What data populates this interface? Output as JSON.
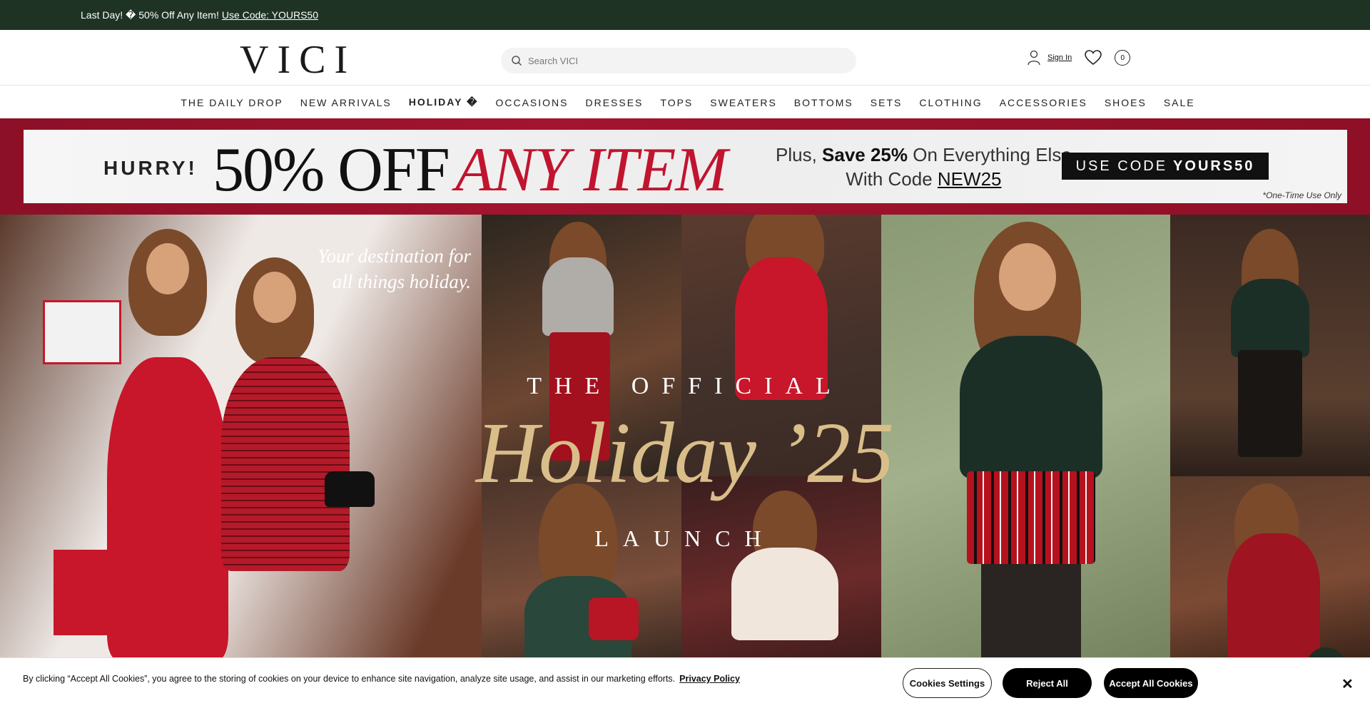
{
  "announcement": {
    "text": "Last Day! \u0000 50% Off Any Item! ",
    "text_clean": "Last Day! � 50% Off Any Item!",
    "code_link": "Use Code: YOURS50"
  },
  "header": {
    "logo": "VICI",
    "search_placeholder": "Search VICI",
    "sign_in": "Sign In",
    "cart_count": "0"
  },
  "nav": {
    "items": [
      {
        "label": "THE DAILY DROP"
      },
      {
        "label": "NEW ARRIVALS"
      },
      {
        "label": "HOLIDAY �"
      },
      {
        "label": "OCCASIONS"
      },
      {
        "label": "DRESSES"
      },
      {
        "label": "TOPS"
      },
      {
        "label": "SWEATERS"
      },
      {
        "label": "BOTTOMS"
      },
      {
        "label": "SETS"
      },
      {
        "label": "CLOTHING"
      },
      {
        "label": "ACCESSORIES"
      },
      {
        "label": "SHOES"
      },
      {
        "label": "SALE"
      }
    ]
  },
  "promo": {
    "hurry": "HURRY!",
    "fifty": "50% OFF",
    "any_item": "ANY ITEM",
    "plus_line1_a": "Plus, ",
    "plus_line1_b": "Save 25%",
    "plus_line1_c": " On Everything Else",
    "plus_line2_a": "With Code ",
    "plus_line2_b": "NEW25",
    "use_code_a": "USE CODE",
    "use_code_b": "YOURS50",
    "one_time": "*One-Time Use Only"
  },
  "hero": {
    "tagline_1": "Your destination for",
    "tagline_2": "all things holiday.",
    "official": "THE OFFICIAL",
    "holiday": "Holiday ’25",
    "launch": "LAUNCH"
  },
  "cookie": {
    "text": "By clicking “Accept All Cookies”, you agree to the storing of cookies on your device to enhance site navigation, analyze site usage, and assist in our marketing efforts.",
    "privacy": "Privacy Policy",
    "settings": "Cookies Settings",
    "reject": "Reject All",
    "accept": "Accept All Cookies",
    "close": "✕"
  },
  "colors": {
    "announce_bg": "#1f3324",
    "promo_red": "#c0142f",
    "hero_gold": "#d9be8a"
  }
}
